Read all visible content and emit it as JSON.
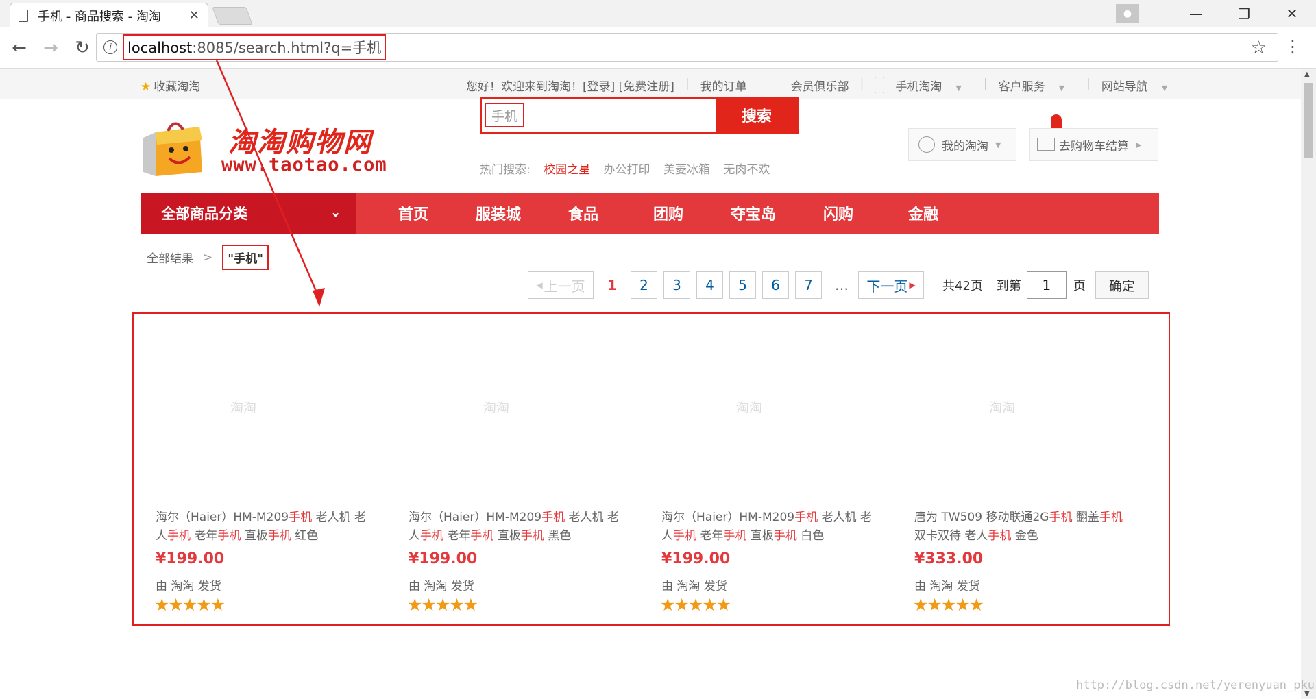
{
  "browser": {
    "tab_title": "手机 - 商品搜索 - 淘淘",
    "url_host": "localhost",
    "url_rest": ":8085/search.html?q=手机"
  },
  "topnav": {
    "favorite": "收藏淘淘",
    "welcome": "您好！欢迎来到淘淘！[登录] [免费注册]",
    "orders": "我的订单",
    "club": "会员俱乐部",
    "mobile": "手机淘淘",
    "service": "客户服务",
    "sitenav": "网站导航"
  },
  "header": {
    "logo_name": "淘淘购物网",
    "logo_domain": "www.taotao.com",
    "search_value": "手机",
    "search_button": "搜索",
    "hot_label": "热门搜索:",
    "hot_items": [
      "校园之星",
      "办公打印",
      "美菱冰箱",
      "无肉不欢"
    ],
    "my_label": "我的淘淘",
    "cart_label": "去购物车结算"
  },
  "mainnav": {
    "all_categories": "全部商品分类",
    "items": [
      "首页",
      "服装城",
      "食品",
      "团购",
      "夺宝岛",
      "闪购",
      "金融"
    ]
  },
  "breadcrumb": {
    "root": "全部结果",
    "keyword": "\"手机\""
  },
  "pager": {
    "prev": "上一页",
    "current": "1",
    "pages": [
      "2",
      "3",
      "4",
      "5",
      "6",
      "7"
    ],
    "dots": "…",
    "next": "下一页",
    "total": "共42页",
    "goto_label": "到第",
    "goto_value": "1",
    "page_unit": "页",
    "confirm": "确定"
  },
  "products": [
    {
      "img_alt": "淘淘",
      "title_parts": [
        "海尔（Haier）HM-M209",
        "手机",
        " 老人机 老人",
        "手机",
        " 老年",
        "手机",
        " 直板",
        "手机",
        " 红色"
      ],
      "price": "¥199.00",
      "ship": "由 淘淘 发货",
      "rating": 5
    },
    {
      "img_alt": "淘淘",
      "title_parts": [
        "海尔（Haier）HM-M209",
        "手机",
        " 老人机 老人",
        "手机",
        " 老年",
        "手机",
        " 直板",
        "手机",
        " 黑色"
      ],
      "price": "¥199.00",
      "ship": "由 淘淘 发货",
      "rating": 5
    },
    {
      "img_alt": "淘淘",
      "title_parts": [
        "海尔（Haier）HM-M209",
        "手机",
        " 老人机 老人",
        "手机",
        " 老年",
        "手机",
        " 直板",
        "手机",
        " 白色"
      ],
      "price": "¥199.00",
      "ship": "由 淘淘 发货",
      "rating": 5
    },
    {
      "img_alt": "淘淘",
      "title_parts": [
        "唐为 TW509 移动联通2G",
        "手机",
        " 翻盖",
        "手机",
        " 双卡双待 老人",
        "手机",
        " 金色"
      ],
      "price": "¥333.00",
      "ship": "由 淘淘 发货",
      "rating": 5
    }
  ],
  "watermark": "http://blog.csdn.net/yerenyuan_pku",
  "colors": {
    "brand_red": "#e4393c",
    "dark_red": "#c81623",
    "annotation_red": "#e02020",
    "star_orange": "#f09a16"
  }
}
